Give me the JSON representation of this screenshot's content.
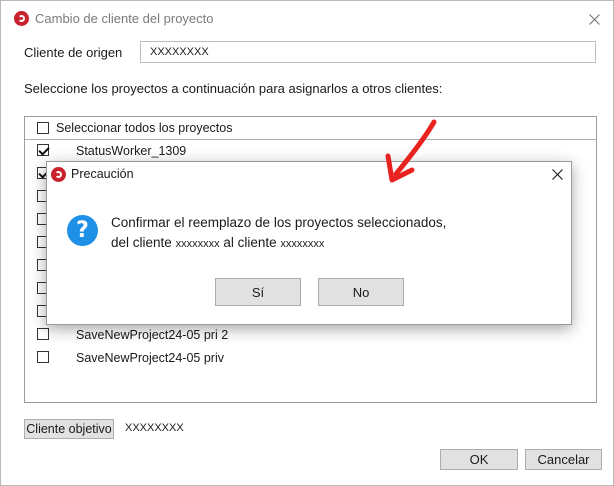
{
  "main": {
    "title": "Cambio de cliente del proyecto",
    "source_label": "Cliente de origen",
    "source_value": "XXXXXXXX",
    "instructions": "Seleccione los proyectos a continuación para asignarlos a otros clientes:",
    "select_all_label": "Seleccionar todos los proyectos",
    "projects": [
      {
        "label": "StatusWorker_1309",
        "checked": true
      },
      {
        "label": "",
        "checked": true
      },
      {
        "label": "",
        "checked": false
      },
      {
        "label": "",
        "checked": false
      },
      {
        "label": "",
        "checked": false
      },
      {
        "label": "",
        "checked": false
      },
      {
        "label": "",
        "checked": false
      },
      {
        "label": "",
        "checked": false
      },
      {
        "label": "SaveNewProject24-05 pri 2",
        "checked": false
      },
      {
        "label": "SaveNewProject24-05 priv",
        "checked": false
      }
    ],
    "target_button_label": "Cliente objetivo",
    "target_value": "XXXXXXXX",
    "ok_label": "OK",
    "cancel_label": "Cancelar"
  },
  "dialog": {
    "title": "Precaución",
    "message_line1": "Confirmar el reemplazo de los proyectos seleccionados,",
    "message_line2_prefix": "del cliente",
    "message_line2_client_from": "xxxxxxxx",
    "message_line2_middle": "al cliente",
    "message_line2_client_to": "xxxxxxxx",
    "yes_label": "Sí",
    "no_label": "No"
  },
  "colors": {
    "app_icon": "#c8232c",
    "question_icon": "#1e90e6",
    "annotation_arrow": "#e8221f"
  },
  "icons": {
    "app": "app-logo-icon",
    "close": "close-icon",
    "question": "question-icon",
    "annotation": "red-arrow-annotation"
  }
}
